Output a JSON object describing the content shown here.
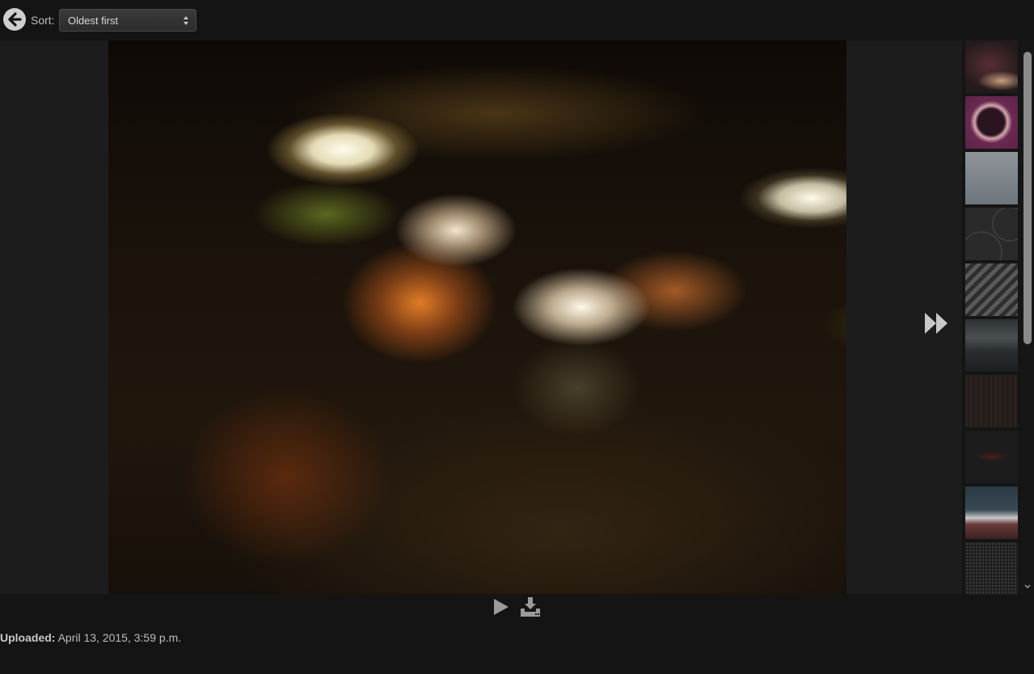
{
  "toolbar": {
    "back_icon": "arrow-left-circle-icon",
    "sort_label": "Sort:",
    "sort_selected": "Oldest first"
  },
  "viewer": {
    "next_icon": "fast-forward-icon"
  },
  "thumbnails": [
    {
      "subject": "abstract light swirl"
    },
    {
      "subject": "purple lens orb"
    },
    {
      "subject": "grey noise texture"
    },
    {
      "subject": "dark circles pattern"
    },
    {
      "subject": "diagonal stripes"
    },
    {
      "subject": "office interior"
    },
    {
      "subject": "dark wood texture"
    },
    {
      "subject": "dark logo"
    },
    {
      "subject": "mountain landscape"
    },
    {
      "subject": "dark mesh pattern"
    }
  ],
  "controls": {
    "play_icon": "play-icon",
    "download_icon": "download-icon"
  },
  "meta": {
    "uploaded_label": "Uploaded:",
    "uploaded_value": "April 13, 2015, 3:59 p.m."
  }
}
